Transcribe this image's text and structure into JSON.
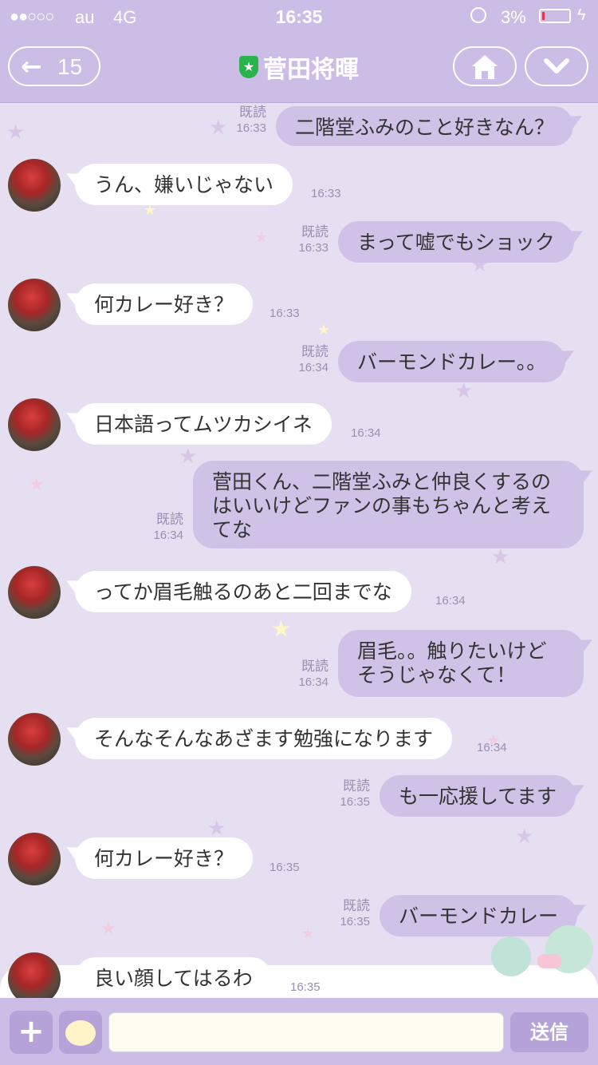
{
  "status": {
    "signal": "●●○○○",
    "carrier": "au",
    "network": "4G",
    "time": "16:35",
    "battery": "3%"
  },
  "header": {
    "back_count": "15",
    "title": "菅田将暉",
    "home_icon": "home-icon",
    "menu_icon": "chevron-down-icon"
  },
  "messages": [
    {
      "side": "right",
      "text": "二階堂ふみのこと好きなん？",
      "read": "既読",
      "time": "16:33"
    },
    {
      "side": "left",
      "text": "うん、嫌いじゃない",
      "time": "16:33"
    },
    {
      "side": "right",
      "text": "まって嘘でもショック",
      "read": "既読",
      "time": "16:33"
    },
    {
      "side": "left",
      "text": "何カレー好き？",
      "time": "16:33"
    },
    {
      "side": "right",
      "text": "バーモンドカレー。。",
      "read": "既読",
      "time": "16:34"
    },
    {
      "side": "left",
      "text": "日本語ってムツカシイネ",
      "time": "16:34"
    },
    {
      "side": "right",
      "text": "菅田くん、二階堂ふみと仲良くするのはいいけどファンの事もちゃんと考えてな",
      "read": "既読",
      "time": "16:34"
    },
    {
      "side": "left",
      "text": "ってか眉毛触るのあと二回までな",
      "time": "16:34"
    },
    {
      "side": "right",
      "text": "眉毛。。触りたいけどそうじゃなくて！",
      "read": "既読",
      "time": "16:34"
    },
    {
      "side": "left",
      "text": "そんなそんなあざます勉強になります",
      "time": "16:34"
    },
    {
      "side": "right",
      "text": "も一応援してます",
      "read": "既読",
      "time": "16:35"
    },
    {
      "side": "left",
      "text": "何カレー好き？",
      "time": "16:35"
    },
    {
      "side": "right",
      "text": "バーモンドカレー",
      "read": "既読",
      "time": "16:35"
    },
    {
      "side": "left",
      "text": "良い顔してはるわ",
      "time": "16:35"
    }
  ],
  "input": {
    "value": "",
    "send_label": "送信"
  }
}
